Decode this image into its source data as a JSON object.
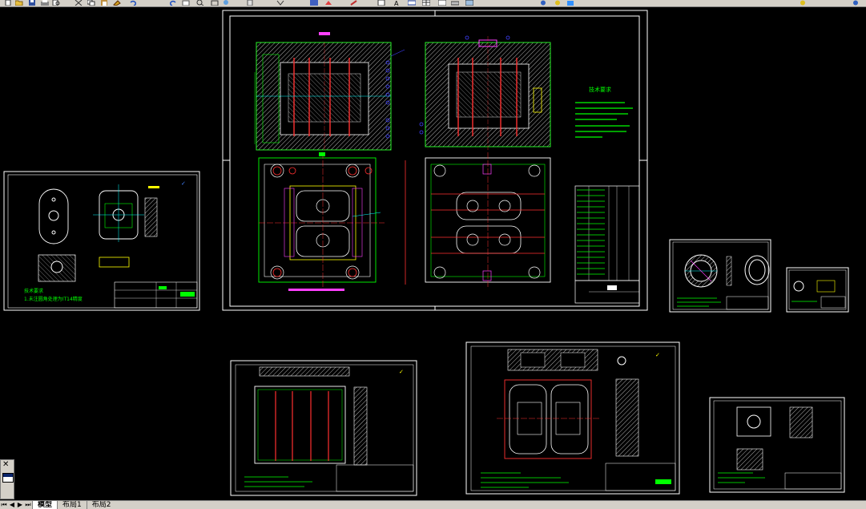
{
  "app": {
    "accent_color": "#d4d0c8",
    "model_background": "#000000"
  },
  "toolbar": {
    "icons": [
      "new-icon",
      "open-icon",
      "save-icon",
      "print-icon",
      "preview-icon",
      "cut-icon",
      "copy-icon",
      "paste-icon",
      "match-icon",
      "undo-icon",
      "redo-icon",
      "pan-icon",
      "zoom-realtime-icon",
      "zoom-window-icon",
      "zoom-previous-icon",
      "properties-icon",
      "design-center-icon",
      "tool-palettes-icon",
      "sheet-set-icon",
      "markup-icon",
      "calculator-icon",
      "text-style-icon",
      "dimension-style-icon",
      "table-style-icon",
      "multileader-style-icon",
      "layer-icon",
      "layer-previous-icon",
      "help-icon"
    ]
  },
  "tabs": {
    "items": [
      {
        "label": "模型",
        "active": true
      },
      {
        "label": "布局1",
        "active": false
      },
      {
        "label": "布局2",
        "active": false
      }
    ]
  },
  "palette": {
    "close_symbol": "✕"
  },
  "drawings": {
    "main_assembly": {
      "tech_title": "技术要求",
      "notes_visible": true
    },
    "left_part": {
      "note_title": "技术要求",
      "note_line": "1.未注圆角处理为IT14精度"
    }
  }
}
